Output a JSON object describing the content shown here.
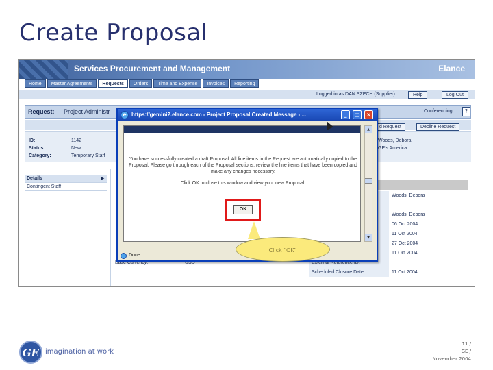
{
  "slide": {
    "title": "Create Proposal",
    "callout": "Click “OK”",
    "tagline": "imagination at work",
    "logo_mark": "GE",
    "footer_page": "11 /",
    "footer_org": "GE /",
    "footer_date": "November 2004"
  },
  "app": {
    "title": "Services Procurement and Management",
    "brand": "Elance",
    "nav_tabs": [
      "Home",
      "Master Agreements",
      "Requests",
      "Orders",
      "Time and Expense",
      "Invoices",
      "Reporting"
    ],
    "active_tab": "Requests",
    "logged_in": "Logged in as DAN SZECH (Supplier)",
    "help_label": "Help",
    "logout_label": "Log Out"
  },
  "request": {
    "label": "Request:",
    "value": "Project Administr",
    "conferencing": "Conferencing",
    "help": "?",
    "id_label": "ID:",
    "id_value": "1142",
    "status_label": "Status:",
    "status_value": "New",
    "category_label": "Category:",
    "category_value": "Temporary Staff",
    "right_name": "Woods, Debora",
    "right_org": "GE's America",
    "btn_create": "d Request",
    "btn_decline": "Decline Request"
  },
  "sidebar": {
    "items": [
      "Details",
      "Contingent Staff"
    ]
  },
  "right_table": {
    "rows": [
      {
        "label": "",
        "value": "Woods, Debora"
      },
      {
        "label": "",
        "value": ""
      },
      {
        "label": "",
        "value": "Woods, Debora"
      },
      {
        "label": "",
        "value": "06 Oct 2004"
      },
      {
        "label": "",
        "value": "11 Oct 2004"
      },
      {
        "label": "",
        "value": "27 Oct 2004"
      },
      {
        "label": "",
        "value": "11 Oct 2004"
      },
      {
        "label": "External Reference ID:",
        "value": ""
      },
      {
        "label": "Scheduled Closure Date:",
        "value": "11 Oct 2004"
      }
    ]
  },
  "base_currency": {
    "label": "Base Currency:",
    "value": "USD"
  },
  "popup": {
    "title": "https://gemini2.elance.com - Project Proposal Created Message - ...",
    "message": "You have successfully created a draft Proposal. All line items in the Request are automatically copied to the Proposal. Please go through each of the Proposal sections, review the line items that have been copied and make any changes necessary.",
    "instruction": "Click OK to close this window and view your new Proposal.",
    "ok_label": "OK",
    "status": "Done"
  },
  "colors": {
    "title": "#27306e",
    "highlight": "#e01a1a",
    "callout": "#fbea7c",
    "ge_blue": "#2f56a3"
  }
}
